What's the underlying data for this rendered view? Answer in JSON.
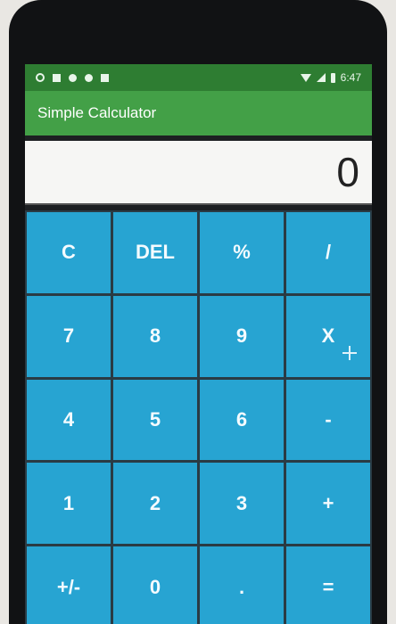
{
  "status": {
    "time": "6:47"
  },
  "app": {
    "title": "Simple Calculator"
  },
  "display": {
    "value": "0"
  },
  "keys": [
    "C",
    "DEL",
    "%",
    "/",
    "7",
    "8",
    "9",
    "X",
    "4",
    "5",
    "6",
    "-",
    "1",
    "2",
    "3",
    "+",
    "+/-",
    "0",
    ".",
    "="
  ],
  "colors": {
    "statusbar": "#2e7d32",
    "appbar": "#43a047",
    "key": "#27a4d2"
  },
  "cursor": {
    "icon": "crosshair-cursor-icon"
  }
}
